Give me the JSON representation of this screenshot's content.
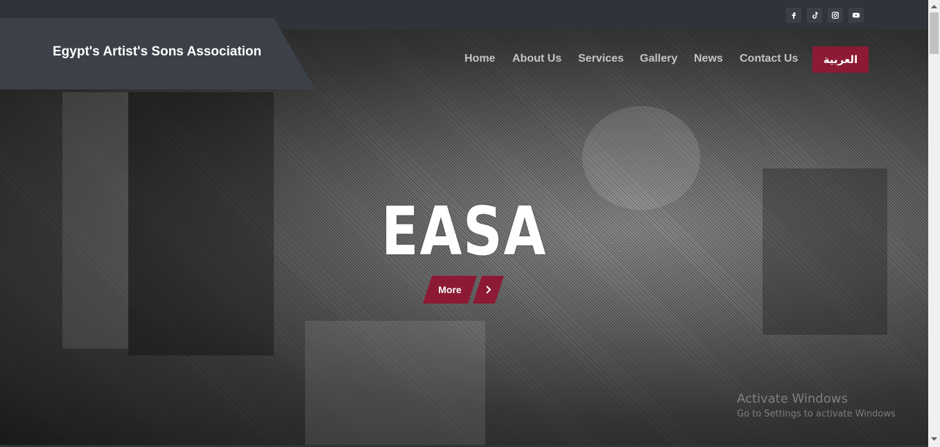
{
  "header": {
    "site_title": "Egypt's Artist's Sons Association",
    "nav": [
      "Home",
      "About Us",
      "Services",
      "Gallery",
      "News",
      "Contact Us"
    ],
    "language_button": "العربية",
    "social_icons": [
      "facebook-icon",
      "tiktok-icon",
      "instagram-icon",
      "youtube-icon"
    ]
  },
  "hero": {
    "headline": "EASA",
    "more_label": "More",
    "arrow_icon": "chevron-right-icon"
  },
  "watermark": {
    "line1": "Activate Windows",
    "line2": "Go to Settings to activate Windows"
  },
  "colors": {
    "accent": "#8c1a35",
    "topbar": "#2f343a",
    "logo_bg": "#3b4049"
  }
}
